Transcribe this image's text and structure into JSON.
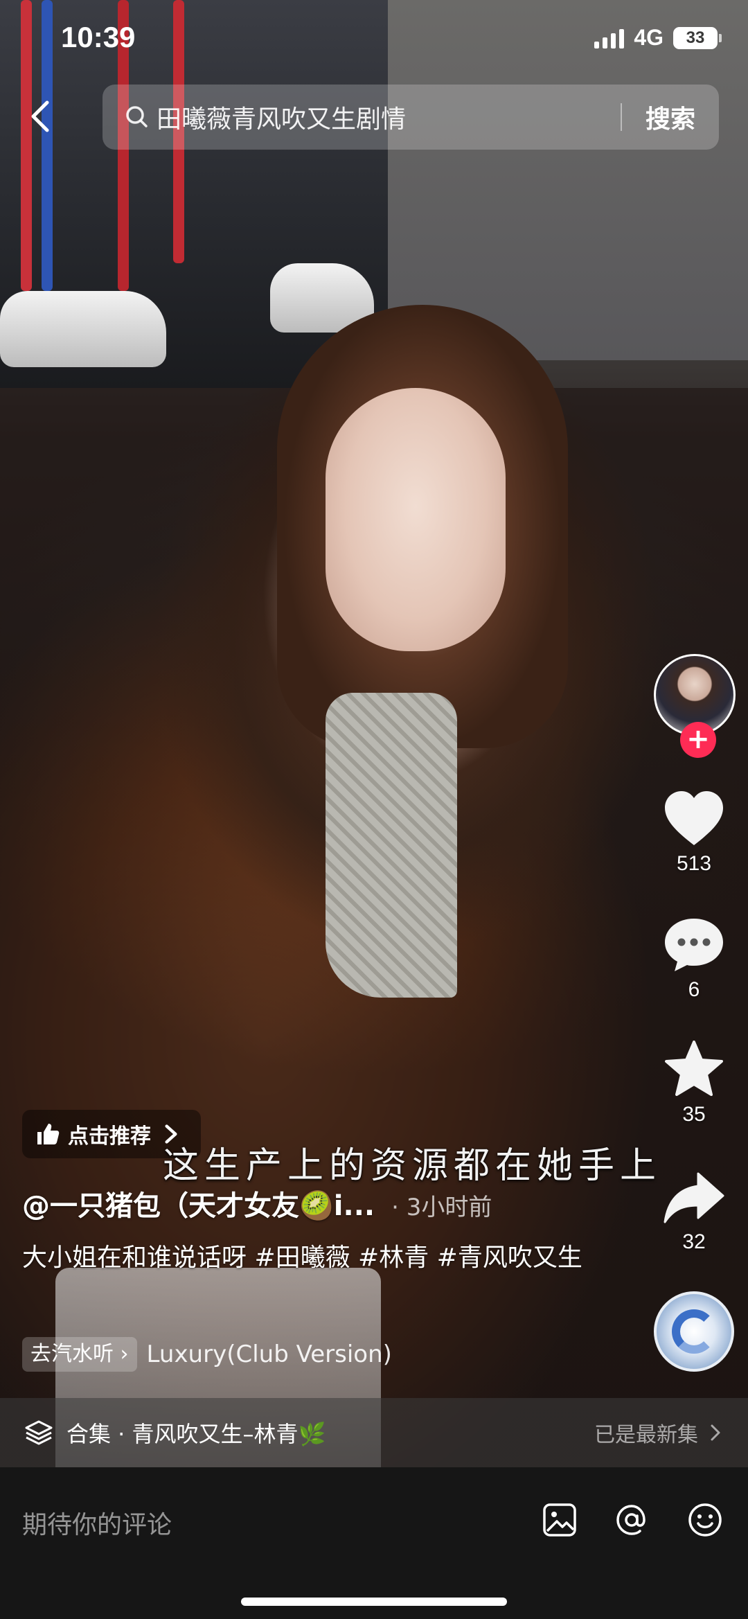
{
  "status_bar": {
    "time": "10:39",
    "network": "4G",
    "battery": "33"
  },
  "search": {
    "query": "田曦薇青风吹又生剧情",
    "button_label": "搜索"
  },
  "actions": {
    "likes": "513",
    "comments": "6",
    "favorites": "35",
    "shares": "32",
    "follow_symbol": "+"
  },
  "video": {
    "recommend_label": "点击推荐",
    "subtitle": "这生产上的资源都在她手上",
    "author": "@一只猪包（天才女友🥝i...",
    "time_ago": "· 3小时前",
    "caption": "大小姐在和谁说话呀 #田曦薇 #林青 #青风吹又生",
    "music_chip": "去汽水听",
    "music_title": "Luxury(Club Version)"
  },
  "collection": {
    "label": "合集 · 青风吹又生–林青🌿",
    "status": "已是最新集"
  },
  "comment_bar": {
    "placeholder": "期待你的评论"
  },
  "icons": {
    "back": "chevron-left-icon",
    "search": "search-icon",
    "like": "heart-icon",
    "comment": "comment-bubble-icon",
    "favorite": "star-icon",
    "share": "share-arrow-icon",
    "collection": "layers-icon",
    "image": "image-icon",
    "mention": "at-icon",
    "emoji": "emoji-icon"
  },
  "colors": {
    "follow_button": "#fe2c55",
    "comment_bar_bg": "#161616"
  }
}
